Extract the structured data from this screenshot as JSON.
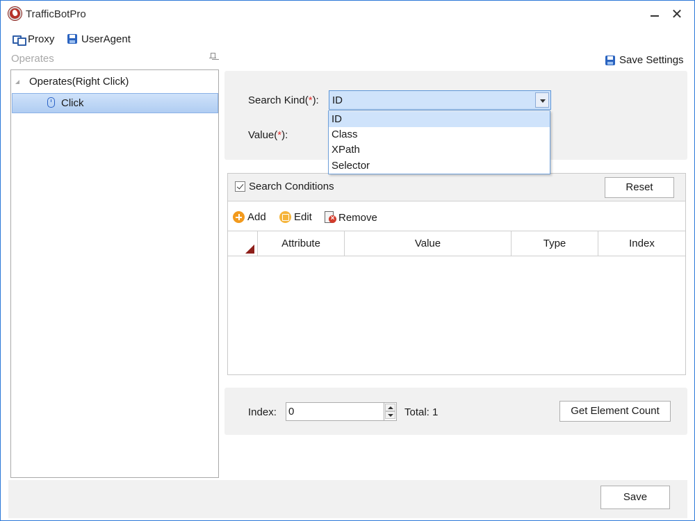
{
  "window": {
    "title": "TrafficBotPro"
  },
  "menu": {
    "proxy": "Proxy",
    "user_agent": "UserAgent"
  },
  "left_pane": {
    "title": "Operates",
    "tree": {
      "root_label": "Operates(Right Click)",
      "child_label": "Click"
    }
  },
  "save_settings": "Save Settings",
  "search": {
    "kind_label": "Search Kind(",
    "value_label": "Value(",
    "required_mark": "*",
    "label_suffix": "):",
    "selected": "ID",
    "options": [
      "ID",
      "Class",
      "XPath",
      "Selector"
    ]
  },
  "conditions": {
    "title": "Search Conditions",
    "checked": true,
    "reset_label": "Reset",
    "toolbar": {
      "add": "Add",
      "edit": "Edit",
      "remove": "Remove"
    },
    "columns": [
      "Attribute",
      "Value",
      "Type",
      "Index"
    ],
    "rows": []
  },
  "index_panel": {
    "index_label": "Index:",
    "index_value": "0",
    "total_label": "Total: 1",
    "count_button": "Get Element Count"
  },
  "footer": {
    "save_label": "Save"
  },
  "colors": {
    "accent": "#2b78d8",
    "selection": "#cfe3fb",
    "required": "#e0322f"
  }
}
